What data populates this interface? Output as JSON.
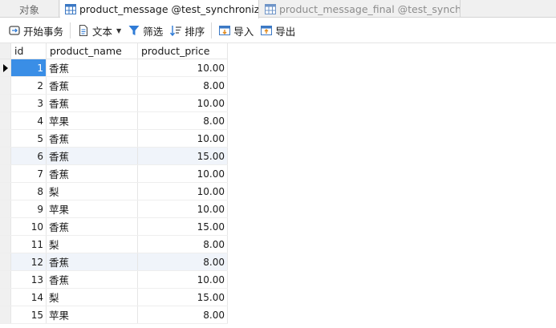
{
  "tabs": {
    "objects": "对象",
    "current": "product_message @test_synchroniza...",
    "other": "product_message_final @test_synchr..."
  },
  "toolbar": {
    "begin_transaction": "开始事务",
    "text": "文本",
    "filter": "筛选",
    "sort": "排序",
    "import": "导入",
    "export": "导出"
  },
  "grid": {
    "columns": [
      "id",
      "product_name",
      "product_price"
    ],
    "rows": [
      {
        "id": "1",
        "name": "香蕉",
        "price": "10.00"
      },
      {
        "id": "2",
        "name": "香蕉",
        "price": "8.00"
      },
      {
        "id": "3",
        "name": "香蕉",
        "price": "10.00"
      },
      {
        "id": "4",
        "name": "苹果",
        "price": "8.00"
      },
      {
        "id": "5",
        "name": "香蕉",
        "price": "10.00"
      },
      {
        "id": "6",
        "name": "香蕉",
        "price": "15.00"
      },
      {
        "id": "7",
        "name": "香蕉",
        "price": "10.00"
      },
      {
        "id": "8",
        "name": "梨",
        "price": "10.00"
      },
      {
        "id": "9",
        "name": "苹果",
        "price": "10.00"
      },
      {
        "id": "10",
        "name": "香蕉",
        "price": "15.00"
      },
      {
        "id": "11",
        "name": "梨",
        "price": "8.00"
      },
      {
        "id": "12",
        "name": "香蕉",
        "price": "8.00"
      },
      {
        "id": "13",
        "name": "香蕉",
        "price": "10.00"
      },
      {
        "id": "14",
        "name": "梨",
        "price": "15.00"
      },
      {
        "id": "15",
        "name": "苹果",
        "price": "8.00"
      }
    ]
  },
  "colors": {
    "selected_cell": "#3a8ee6",
    "accent": "#2f7bd6"
  }
}
